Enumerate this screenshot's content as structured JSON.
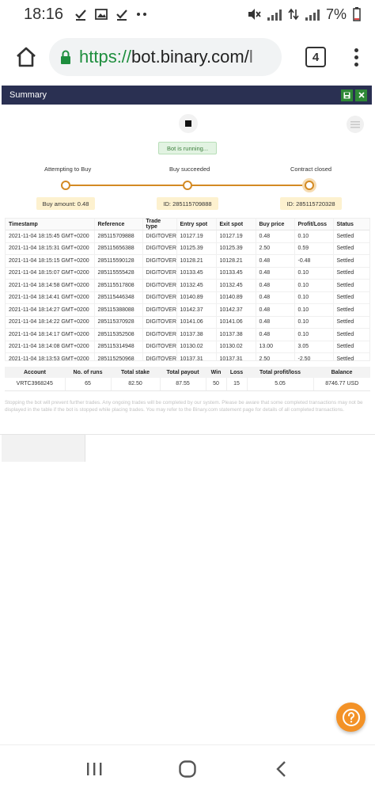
{
  "status_bar": {
    "time": "18:16",
    "battery": "7%",
    "left_icons": [
      "check-icon",
      "image-icon",
      "check-icon",
      "more-dots-icon"
    ],
    "right_icons": [
      "mute-icon",
      "signal-icon",
      "data-arrows-icon",
      "signal-icon",
      "battery-icon"
    ]
  },
  "browser": {
    "url_scheme": "https://",
    "url_domain": "bot.binary.com/",
    "url_rest": "l",
    "tab_count": "4"
  },
  "summary": {
    "title": "Summary",
    "running_text": "Bot is running...",
    "steps": {
      "attempting": "Attempting to Buy",
      "succeeded": "Buy succeeded",
      "closed": "Contract closed"
    },
    "step_boxes": {
      "buy_amount": "Buy amount: 0.48",
      "buy_id": "ID: 285115709888",
      "close_id": "ID: 285115720328"
    }
  },
  "transactions": {
    "headers": [
      "Timestamp",
      "Reference",
      "Trade type",
      "Entry spot",
      "Exit spot",
      "Buy price",
      "Profit/Loss",
      "Status"
    ],
    "rows": [
      [
        "2021-11-04 18:15:45 GMT+0200",
        "285115709888",
        "DIGITOVER",
        "10127.19",
        "10127.19",
        "0.48",
        "0.10",
        "Settled"
      ],
      [
        "2021-11-04 18:15:31 GMT+0200",
        "285115656388",
        "DIGITOVER",
        "10125.39",
        "10125.39",
        "2.50",
        "0.59",
        "Settled"
      ],
      [
        "2021-11-04 18:15:15 GMT+0200",
        "285115590128",
        "DIGITOVER",
        "10128.21",
        "10128.21",
        "0.48",
        "-0.48",
        "Settled"
      ],
      [
        "2021-11-04 18:15:07 GMT+0200",
        "285115555428",
        "DIGITOVER",
        "10133.45",
        "10133.45",
        "0.48",
        "0.10",
        "Settled"
      ],
      [
        "2021-11-04 18:14:58 GMT+0200",
        "285115517808",
        "DIGITOVER",
        "10132.45",
        "10132.45",
        "0.48",
        "0.10",
        "Settled"
      ],
      [
        "2021-11-04 18:14:41 GMT+0200",
        "285115446348",
        "DIGITOVER",
        "10140.89",
        "10140.89",
        "0.48",
        "0.10",
        "Settled"
      ],
      [
        "2021-11-04 18:14:27 GMT+0200",
        "285115388088",
        "DIGITOVER",
        "10142.37",
        "10142.37",
        "0.48",
        "0.10",
        "Settled"
      ],
      [
        "2021-11-04 18:14:22 GMT+0200",
        "285115370928",
        "DIGITOVER",
        "10141.06",
        "10141.06",
        "0.48",
        "0.10",
        "Settled"
      ],
      [
        "2021-11-04 18:14:17 GMT+0200",
        "285115352508",
        "DIGITOVER",
        "10137.38",
        "10137.38",
        "0.48",
        "0.10",
        "Settled"
      ],
      [
        "2021-11-04 18:14:08 GMT+0200",
        "285115314948",
        "DIGITOVER",
        "10130.02",
        "10130.02",
        "13.00",
        "3.05",
        "Settled"
      ],
      [
        "2021-11-04 18:13:53 GMT+0200",
        "285115250968",
        "DIGITOVER",
        "10137.31",
        "10137.31",
        "2.50",
        "-2.50",
        "Settled"
      ]
    ]
  },
  "stats": {
    "headers": [
      "Account",
      "No. of runs",
      "Total stake",
      "Total payout",
      "Win",
      "Loss",
      "Total profit/loss",
      "Balance"
    ],
    "values": [
      "VRTC3968245",
      "65",
      "82.50",
      "87.55",
      "50",
      "15",
      "5.05",
      "8746.77 USD"
    ]
  },
  "disclaimer": "Stopping the bot will prevent further trades. Any ongoing trades will be completed by our system. Please be aware that some completed transactions may not be displayed in the table if the bot is stopped while placing trades. You may refer to the Binary.com statement page for details of all completed transactions.",
  "colors": {
    "header_bg": "#2a3052",
    "accent_orange": "#d38a24",
    "help_orange": "#f39227",
    "profit_green": "#3f9a3f",
    "loss_red": "#e34848"
  }
}
